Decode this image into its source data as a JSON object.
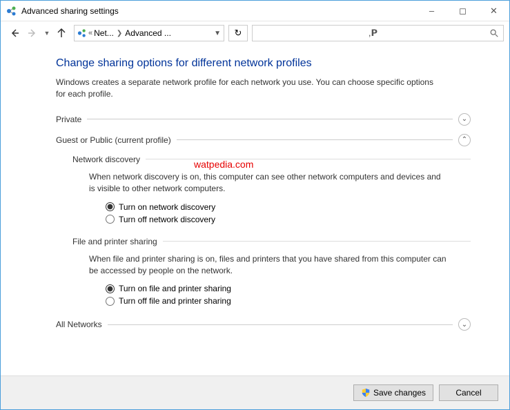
{
  "titlebar": {
    "title": "Advanced sharing settings"
  },
  "breadcrumb": {
    "crumb1": "Net...",
    "crumb2": "Advanced ..."
  },
  "main": {
    "heading": "Change sharing options for different network profiles",
    "subtext": "Windows creates a separate network profile for each network you use. You can choose specific options for each profile."
  },
  "sections": {
    "private": {
      "label": "Private"
    },
    "guest": {
      "label": "Guest or Public (current profile)",
      "network_discovery": {
        "title": "Network discovery",
        "desc": "When network discovery is on, this computer can see other network computers and devices and is visible to other network computers.",
        "opt_on": "Turn on network discovery",
        "opt_off": "Turn off network discovery"
      },
      "file_sharing": {
        "title": "File and printer sharing",
        "desc": "When file and printer sharing is on, files and printers that you have shared from this computer can be accessed by people on the network.",
        "opt_on": "Turn on file and printer sharing",
        "opt_off": "Turn off file and printer sharing"
      }
    },
    "all": {
      "label": "All Networks"
    }
  },
  "footer": {
    "save": "Save changes",
    "cancel": "Cancel"
  },
  "watermark": "watpedia.com"
}
